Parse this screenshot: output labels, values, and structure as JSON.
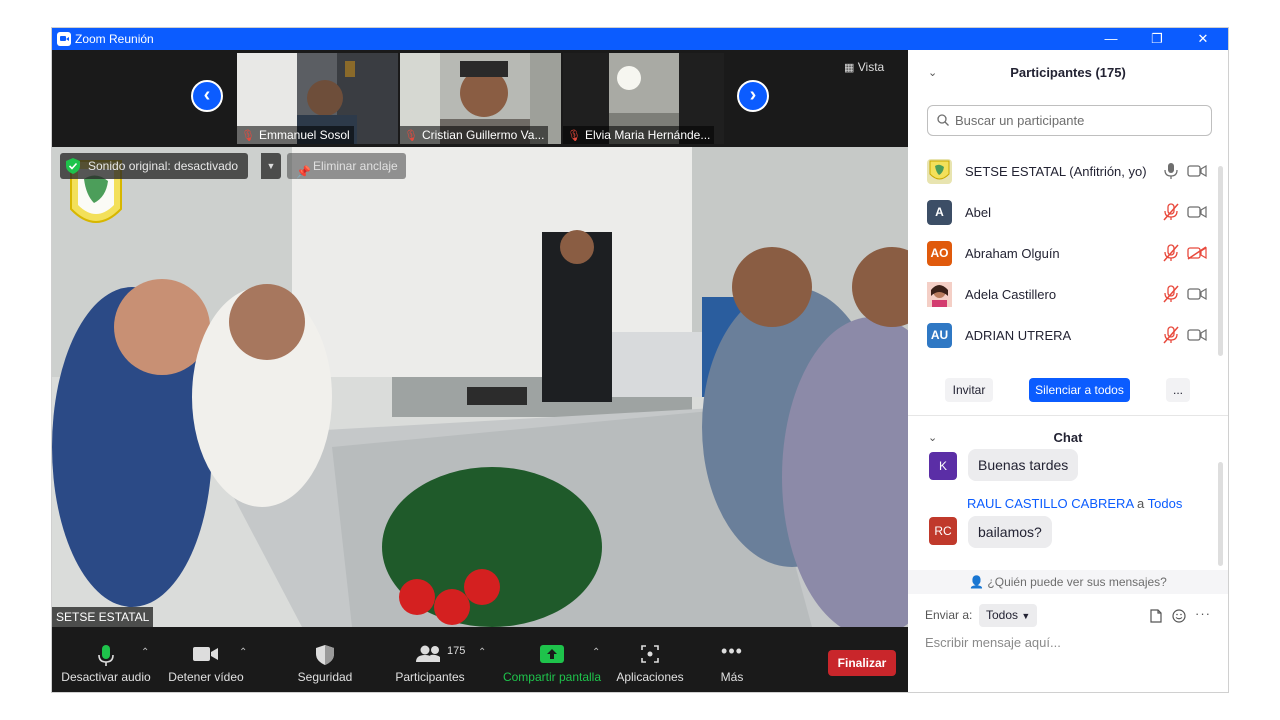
{
  "window": {
    "title": "Zoom Reunión",
    "minimize": "—",
    "restore": "❐",
    "close": "✕"
  },
  "strip": {
    "thumbnails": [
      {
        "name": "Emmanuel Sosol"
      },
      {
        "name": "Cristian Guillermo Va..."
      },
      {
        "name": "Elvia Maria Hernánde..."
      }
    ],
    "prev_label": "‹",
    "next_label": "›",
    "view_label": "Vista"
  },
  "main_video": {
    "original_sound": "Sonido original: desactivado",
    "unpin": "Eliminar anclaje",
    "participant_name": "SETSE ESTATAL"
  },
  "toolbar": {
    "mute": "Desactivar audio",
    "stop_video": "Detener vídeo",
    "security": "Seguridad",
    "participants": "Participantes",
    "participants_count": "175",
    "share": "Compartir pantalla",
    "apps": "Aplicaciones",
    "more": "Más",
    "end": "Finalizar"
  },
  "participants_panel": {
    "title": "Participantes (175)",
    "search_placeholder": "Buscar un participante",
    "list": [
      {
        "name": "SETSE ESTATAL (Anfitrión, yo)",
        "initials": "",
        "color": "#e8e4b0",
        "muted": false,
        "video_off": false
      },
      {
        "name": "Abel",
        "initials": "A",
        "color": "#3c4e66",
        "muted": true,
        "video_off": false
      },
      {
        "name": "Abraham Olguín",
        "initials": "AO",
        "color": "#e05a0c",
        "muted": true,
        "video_off": true
      },
      {
        "name": "Adela Castillero",
        "initials": "",
        "color": "#f2b8b0",
        "muted": true,
        "video_off": false
      },
      {
        "name": "ADRIAN UTRERA",
        "initials": "AU",
        "color": "#2f78c4",
        "muted": true,
        "video_off": false
      }
    ],
    "invite": "Invitar",
    "mute_all": "Silenciar a todos",
    "more": "..."
  },
  "chat": {
    "title": "Chat",
    "messages": [
      {
        "avatar": "K",
        "avatar_color": "#5b2ea6",
        "text": "Buenas tardes"
      },
      {
        "sender": "RAUL CASTILLO CABRERA",
        "recipient_prefix": "a",
        "recipient": "Todos",
        "avatar": "RC",
        "avatar_color": "#c0392b",
        "text": "bailamos?"
      }
    ],
    "who_can_see": "¿Quién puede ver sus mensajes?",
    "send_to_label": "Enviar a:",
    "send_to_value": "Todos",
    "input_placeholder": "Escribir mensaje aquí..."
  },
  "colors": {
    "accent": "#0b5cff",
    "end": "#c9262b",
    "share": "#1ec34b",
    "muted": "#e8493c"
  }
}
